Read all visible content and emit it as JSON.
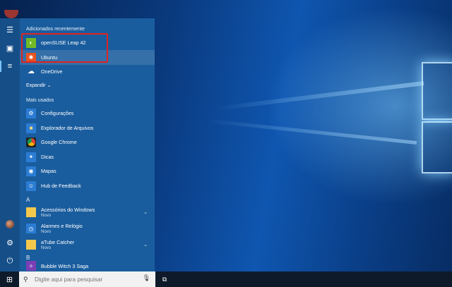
{
  "sections": {
    "recent": "Adicionados recentemente",
    "most_used": "Mais usados",
    "a": "A",
    "b": "B"
  },
  "recent_apps": [
    {
      "label": "openSUSE Leap 42",
      "icon": "opensuse-icon",
      "color": "#73ba25"
    },
    {
      "label": "Ubuntu",
      "icon": "ubuntu-icon",
      "color": "#e95420"
    },
    {
      "label": "OneDrive",
      "icon": "onedrive-icon",
      "color": "#1a5d9e"
    }
  ],
  "expand_label": "Expandir",
  "most_used_apps": [
    {
      "label": "Configurações",
      "icon": "gear-icon"
    },
    {
      "label": "Explorador de Arquivos",
      "icon": "folder-icon"
    },
    {
      "label": "Google Chrome",
      "icon": "chrome-icon"
    },
    {
      "label": "Dicas",
      "icon": "lightbulb-icon"
    },
    {
      "label": "Mapas",
      "icon": "map-icon"
    },
    {
      "label": "Hub de Feedback",
      "icon": "feedback-icon"
    }
  ],
  "a_apps": [
    {
      "label": "Acessórios do Windows",
      "sub": "Novo",
      "icon": "folder-icon"
    },
    {
      "label": "Alarmes e Relógio",
      "sub": "Novo",
      "icon": "clock-icon"
    },
    {
      "label": "aTube Catcher",
      "sub": "Novo",
      "icon": "folder-icon"
    }
  ],
  "b_apps": [
    {
      "label": "Bubble Witch 3 Saga",
      "icon": "game-icon"
    }
  ],
  "search": {
    "placeholder": "Digite aqui para pesquisar"
  },
  "colors": {
    "highlight_box": "#e0231f",
    "menu_bg": "#1a5d9e",
    "taskbar": "#0e1a2a"
  }
}
